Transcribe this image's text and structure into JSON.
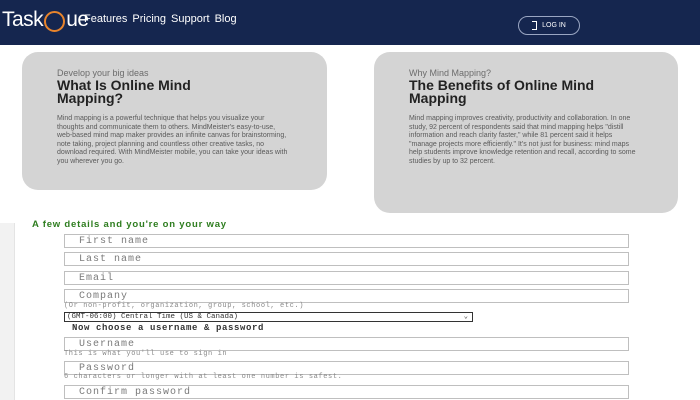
{
  "header": {
    "logo_prefix": "Task",
    "logo_suffix": "ue",
    "nav": [
      "Features",
      "Pricing",
      "Support",
      "Blog"
    ],
    "login_label": "LOG IN"
  },
  "cards": [
    {
      "eyebrow": "Develop your big ideas",
      "title": "What Is Online Mind Mapping?",
      "body": "Mind mapping is a powerful technique that helps you visualize your thoughts and communicate them to others. MindMeister's easy-to-use, web-based mind map maker provides an infinite canvas for brainstorming, note taking, project planning and countless other creative tasks, no download required. With MindMeister mobile, you can take your ideas with you wherever you go."
    },
    {
      "eyebrow": "Why Mind Mapping?",
      "title": "The Benefits of Online Mind Mapping",
      "body": "Mind mapping improves creativity, productivity and collaboration. In one study, 92 percent of respondents said that mind mapping helps \"distill information and reach clarity faster,\" while 81 percent said it helps \"manage projects more efficiently.\" It's not just for business: mind maps help students improve knowledge retention and recall, according to some studies by up to 32 percent."
    }
  ],
  "form": {
    "heading": "A few details and you're on your way",
    "first_name": "First name",
    "last_name": "Last name",
    "email": "Email",
    "company": "Company",
    "company_hint": "(Or non-profit, organization, group, school, etc.)",
    "timezone": "(GMT-06:00) Central Time (US & Canada)",
    "username_heading": "Now choose a username & password",
    "username": "Username",
    "username_hint": "This is what you'll use to sign in",
    "password": "Password",
    "password_hint": "6 characters or longer with at least one number is safest.",
    "confirm_password": "Confirm password"
  },
  "colors": {
    "header_bg": "#15264f",
    "accent": "#e8842c",
    "card_bg": "#d4d4d4",
    "form_heading": "#2e7d1f"
  }
}
